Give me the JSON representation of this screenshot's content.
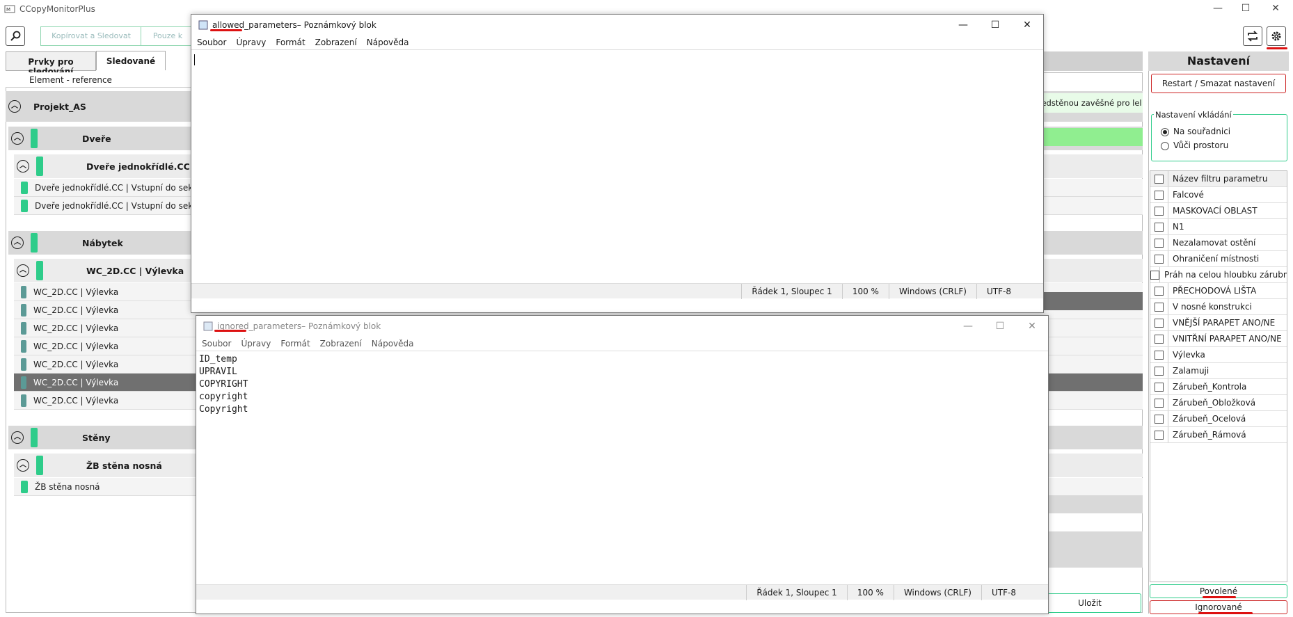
{
  "app": {
    "title": "CCopyMonitorPlus",
    "min": "—",
    "max": "☐",
    "close": "✕"
  },
  "toolbar": {
    "copy_track": "Kopírovat a Sledovat",
    "use_only": "Pouze k"
  },
  "tabs": [
    "Prvky pro sledování",
    "Sledované"
  ],
  "tree": {
    "column_header": "Element - reference",
    "project": "Projekt_AS",
    "groups": [
      {
        "name": "Dveře",
        "subgroup": "Dveře jednokřídlé.CC | Vstu",
        "items": [
          "Dveře jednokřídlé.CC | Vstupní do sekce",
          "Dveře jednokřídlé.CC | Vstupní do sekce"
        ]
      },
      {
        "name": "Nábytek",
        "subgroup": "WC_2D.CC | Výlevka",
        "items": [
          "WC_2D.CC | Výlevka",
          "WC_2D.CC | Výlevka",
          "WC_2D.CC | Výlevka",
          "WC_2D.CC | Výlevka",
          "WC_2D.CC | Výlevka",
          "WC_2D.CC | Výlevka",
          "WC_2D.CC | Výlevka"
        ]
      },
      {
        "name": "Stěny",
        "subgroup": "ŽB stěna nosná",
        "items": [
          "ŽB stěna nosná"
        ]
      }
    ],
    "right_snippet": "ředstěnou zavěšné pro lel"
  },
  "notepad_allowed": {
    "filename": "allowed_parameters",
    "title_suffix": " – Poznámkový blok",
    "menu": [
      "Soubor",
      "Úpravy",
      "Formát",
      "Zobrazení",
      "Nápověda"
    ],
    "content": "",
    "status": {
      "pos": "Řádek 1, Sloupec 1",
      "zoom": "100 %",
      "eol": "Windows (CRLF)",
      "enc": "UTF-8"
    }
  },
  "notepad_ignored": {
    "filename": "ignored_parameters",
    "title_suffix": " – Poznámkový blok",
    "menu": [
      "Soubor",
      "Úpravy",
      "Formát",
      "Zobrazení",
      "Nápověda"
    ],
    "content": "ID_temp\nUPRAVIL\nCOPYRIGHT\ncopyright\nCopyright",
    "status": {
      "pos": "Řádek 1, Sloupec 1",
      "zoom": "100 %",
      "eol": "Windows (CRLF)",
      "enc": "UTF-8"
    }
  },
  "bottom": {
    "save": "Uložit"
  },
  "settings": {
    "title": "Nastavení",
    "reset_button": "Restart / Smazat nastavení",
    "insert_group": "Nastavení vkládání",
    "radio_coords": "Na souřadnici",
    "radio_space": "Vůči prostoru",
    "filter_header": "Název filtru parametru",
    "filters": [
      "Falcové",
      "MASKOVACÍ OBLAST",
      "N1",
      "Nezalamovat ostění",
      "Ohraničení místnosti",
      "Práh na celou hloubku zárubně",
      "PŘECHODOVÁ LIŠTA",
      "V nosné konstrukci",
      "VNĚJŠÍ PARAPET ANO/NE",
      "VNITŘNÍ PARAPET ANO/NE",
      "Výlevka",
      "Zalamuji",
      "Zárubeň_Kontrola",
      "Zárubeň_Obložková",
      "Zárubeň_Ocelová",
      "Zárubeň_Rámová"
    ],
    "allowed_button": "Povolené",
    "ignored_button": "Ignorované"
  },
  "colors": {
    "accent_green": "#2ecc8a",
    "highlight_red": "#d11111"
  }
}
